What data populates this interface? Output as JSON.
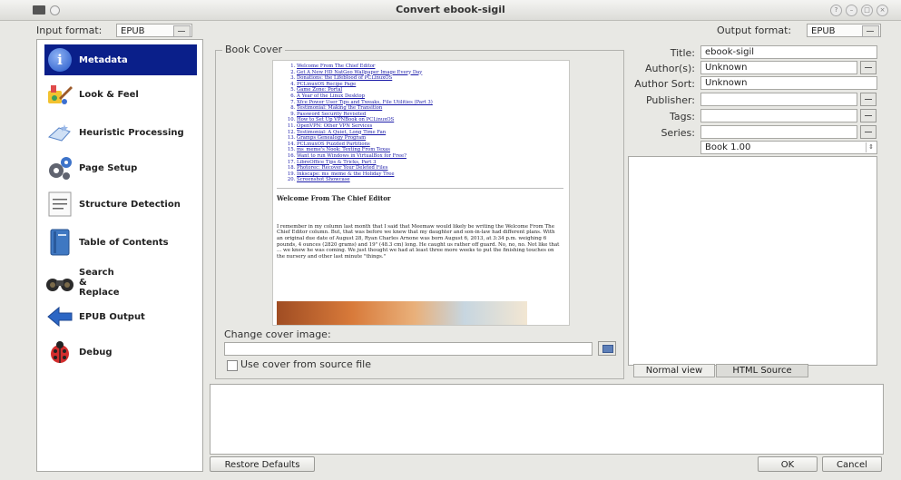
{
  "window": {
    "title": "Convert ebook-sigil"
  },
  "input_format": {
    "label": "Input format:",
    "value": "EPUB"
  },
  "output_format": {
    "label": "Output format:",
    "value": "EPUB"
  },
  "sidebar": {
    "items": [
      {
        "label": "Metadata",
        "icon": "info-icon"
      },
      {
        "label": "Look & Feel",
        "icon": "paint-brush-icon"
      },
      {
        "label": "Heuristic Processing",
        "icon": "wand-icon"
      },
      {
        "label": "Page Setup",
        "icon": "gears-icon"
      },
      {
        "label": "Structure Detection",
        "icon": "document-lines-icon"
      },
      {
        "label": "Table of Contents",
        "icon": "book-icon"
      },
      {
        "label": "Search & Replace",
        "icon": "binoculars-icon"
      },
      {
        "label": "EPUB Output",
        "icon": "arrow-left-icon"
      },
      {
        "label": "Debug",
        "icon": "ladybug-icon"
      }
    ]
  },
  "book_cover": {
    "title": "Book Cover",
    "toc": [
      "Welcome From The Chief Editor",
      "Get A New HD NatGeo Wallpaper Image Every Day",
      "Donations: the Lifeblood of PCLinuxOS",
      "PCLinuxOS Recipe Page",
      "Game Zone: Portal",
      "A Year of the Linux Desktop",
      "Xfce Power User Tips and Tweaks, File Utilities (Part 3)",
      "Testimonial: Making the Transition",
      "Password Security Revisited",
      "How to Set Up VPNBook on PCLinuxOS",
      "OpenVPN: Other VPN Services",
      "Testimonial: A Quiet, Long Time Fan",
      "Gramps Genealogy Program",
      "PCLinuxOS Puzzled Partitions",
      "ms_meme's Nook: Texting From Texas",
      "Want to run Windows in VirtualBox for Free?",
      "LibreOffice Tips & Tricks, Part 3",
      "Photorec: Recover Your Deleted Files",
      "Inkscape: ms_meme & the Holiday Tree",
      "Screenshot Showcase"
    ],
    "heading": "Welcome From The Chief Editor",
    "body": "I remember in my column last month that I said that Meemaw would likely be writing the Welcome From The Chief Editor column. But, that was before we knew that my daughter and son-in-law had different plans. With an original due date of August 28, Ryan Charles Arnone was born August 6, 2013, at 3:34 p.m. weighing 6 pounds, 4 ounces (2820 grams) and 19\" (48.3 cm) long. He caught us rather off guard. No, no, no. Not like that ... we knew he was coming. We just thought we had at least three more weeks to put the finishing touches on the nursery and other last minute \"things.\"",
    "change_label": "Change cover image:",
    "change_value": "",
    "use_source_label": "Use cover from source file"
  },
  "metadata": {
    "title_label": "Title:",
    "title_value": "ebook-sigil",
    "authors_label": "Author(s):",
    "authors_value": "Unknown",
    "author_sort_label": "Author Sort:",
    "author_sort_value": "Unknown",
    "publisher_label": "Publisher:",
    "publisher_value": "",
    "tags_label": "Tags:",
    "tags_value": "",
    "series_label": "Series:",
    "series_value": "",
    "series_index": "Book 1.00"
  },
  "tabs": {
    "normal": "Normal view",
    "html": "HTML Source"
  },
  "buttons": {
    "restore": "Restore Defaults",
    "ok": "OK",
    "cancel": "Cancel"
  }
}
